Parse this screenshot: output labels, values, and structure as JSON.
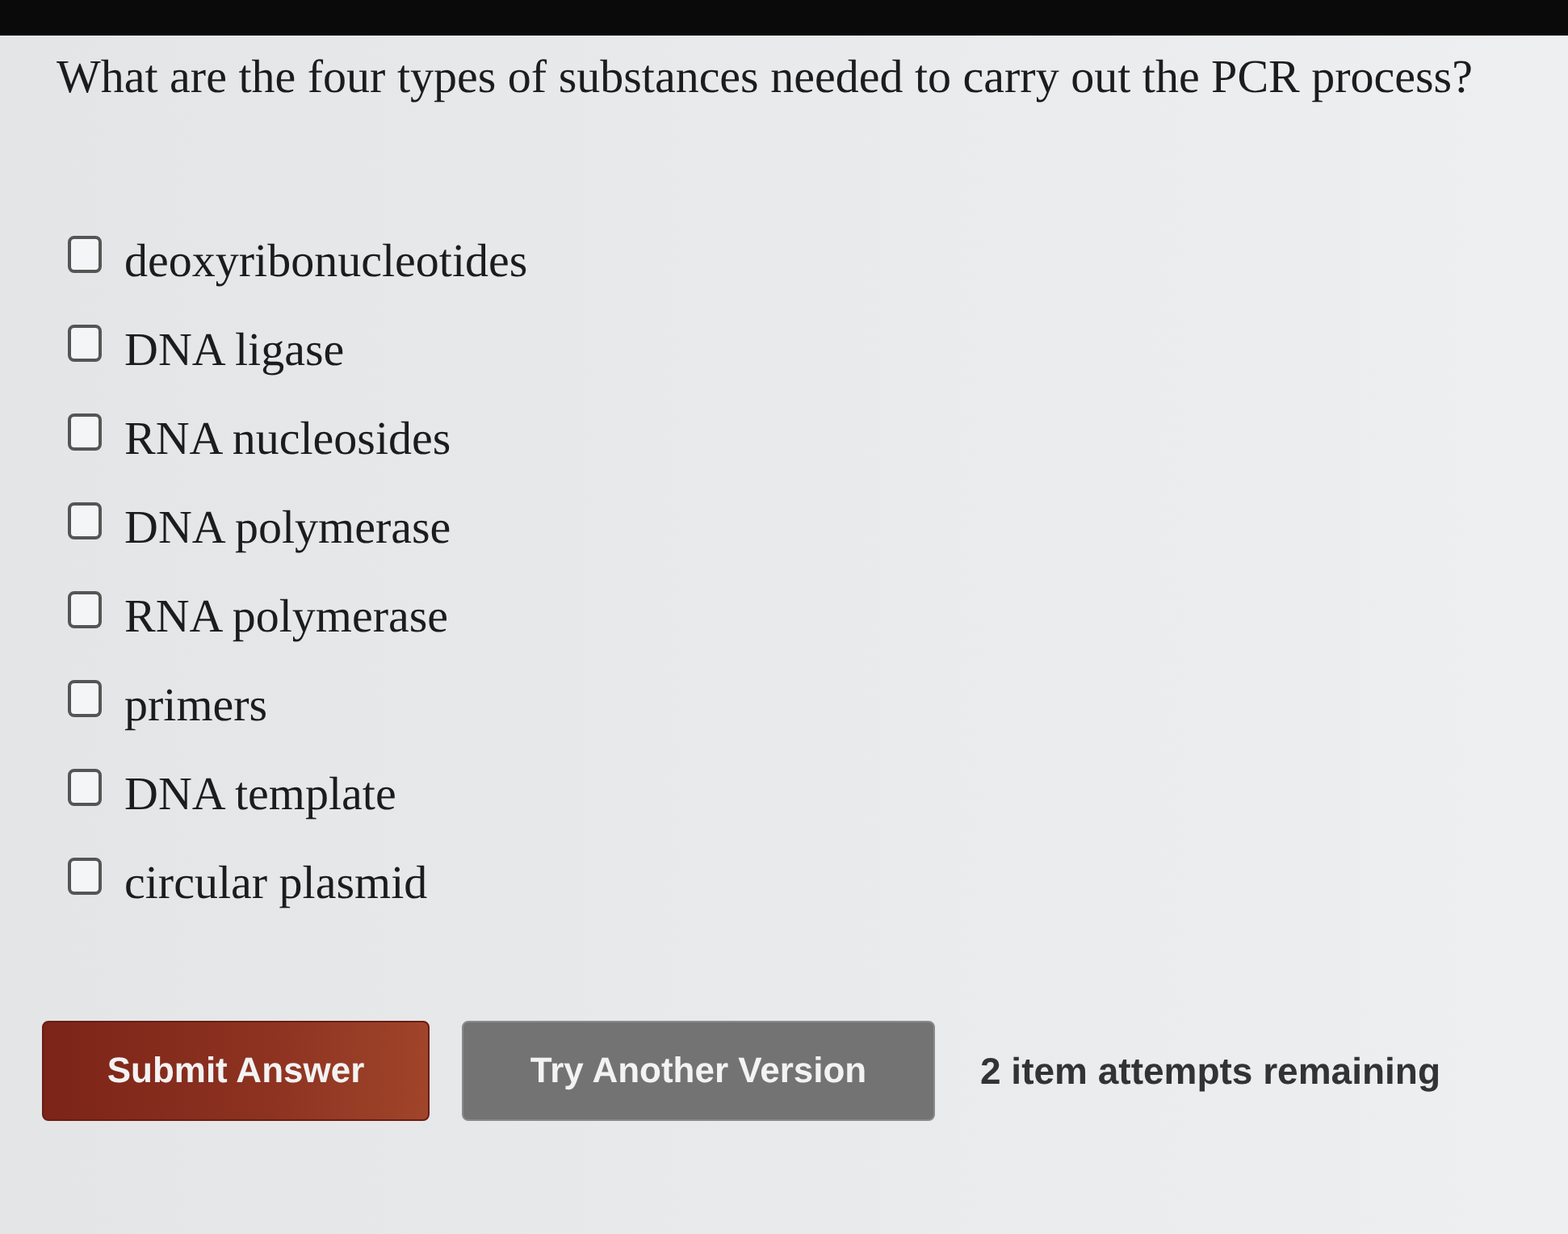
{
  "question": "What are the four types of substances needed to carry out the PCR process?",
  "options": [
    {
      "label": "deoxyribonucleotides",
      "checked": false
    },
    {
      "label": "DNA ligase",
      "checked": false
    },
    {
      "label": "RNA nucleosides",
      "checked": false
    },
    {
      "label": "DNA polymerase",
      "checked": false
    },
    {
      "label": "RNA polymerase",
      "checked": false
    },
    {
      "label": "primers",
      "checked": false
    },
    {
      "label": "DNA template",
      "checked": false
    },
    {
      "label": "circular plasmid",
      "checked": false
    }
  ],
  "buttons": [
    {
      "label": "Submit Answer",
      "kind": "primary"
    },
    {
      "label": "Try Another Version",
      "kind": "secondary"
    }
  ],
  "attempts": "2 item attempts remaining"
}
